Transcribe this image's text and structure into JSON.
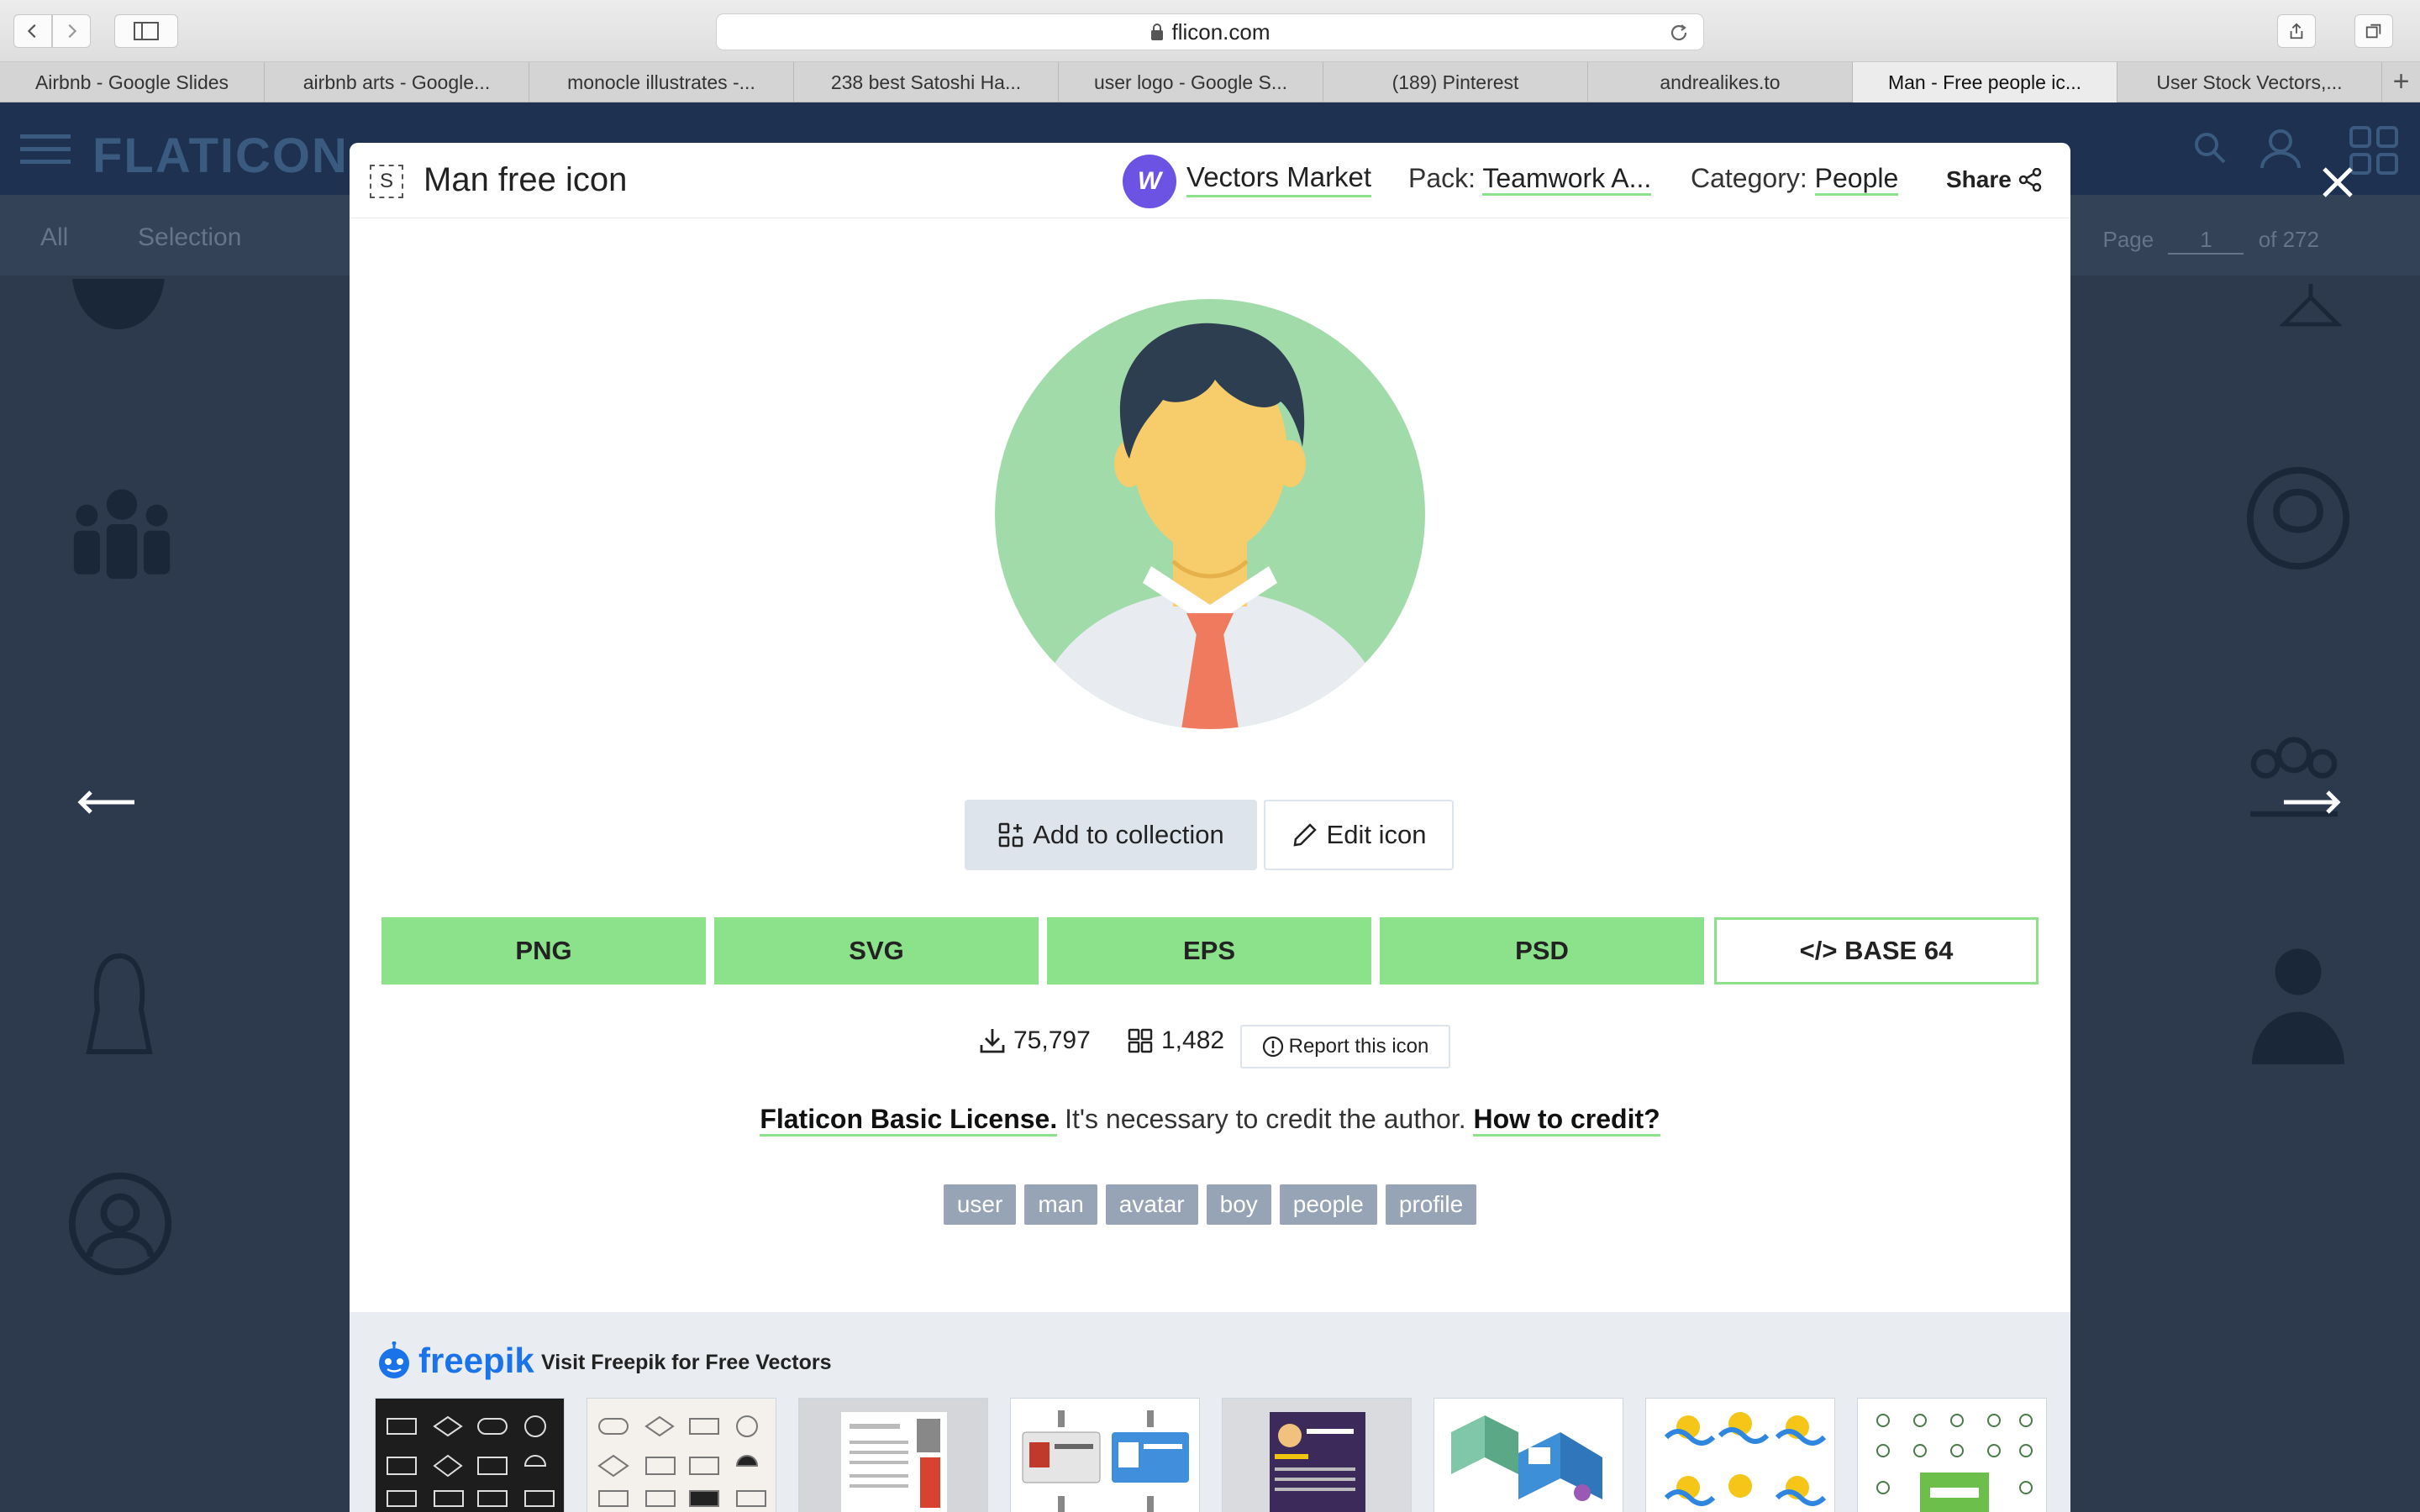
{
  "browser": {
    "url": "flicon.com",
    "tabs": [
      "Airbnb - Google Slides",
      "airbnb arts - Google...",
      "monocle illustrates -...",
      "238 best Satoshi Ha...",
      "user logo - Google S...",
      "(189) Pinterest",
      "andrealikes.to",
      "Man - Free people ic...",
      "User Stock Vectors,..."
    ],
    "active_tab_index": 7
  },
  "background": {
    "logo": "FLATICON",
    "subnav": {
      "all": "All",
      "selection": "Selection"
    },
    "pagination": {
      "label": "Page",
      "current": "1",
      "total": "of 272"
    }
  },
  "modal": {
    "title": "Man free icon",
    "selection_badge": "S",
    "author": "Vectors Market",
    "author_badge": "W",
    "pack_label": "Pack:",
    "pack_value": "Teamwork A...",
    "category_label": "Category:",
    "category_value": "People",
    "share_label": "Share",
    "add_collection_label": "Add to collection",
    "edit_icon_label": "Edit icon",
    "formats": [
      "PNG",
      "SVG",
      "EPS",
      "PSD",
      "</> BASE 64"
    ],
    "downloads": "75,797",
    "collections": "1,482",
    "report_label": "Report this icon",
    "license_link": "Flaticon Basic License.",
    "license_text": " It's necessary to credit the author. ",
    "credit_link": "How to credit?",
    "tags": [
      "user",
      "man",
      "avatar",
      "boy",
      "people",
      "profile"
    ],
    "freepik_logo": "freepik",
    "freepik_text": "Visit Freepik for Free Vectors"
  },
  "colors": {
    "accent_green": "#8be28a",
    "avatar_bg": "#a2dbaa",
    "hair": "#2d3e50",
    "skin": "#f6cd6a",
    "tie": "#f07a5e",
    "author_purple": "#6d53e3",
    "tag_bg": "#97a4b6"
  }
}
